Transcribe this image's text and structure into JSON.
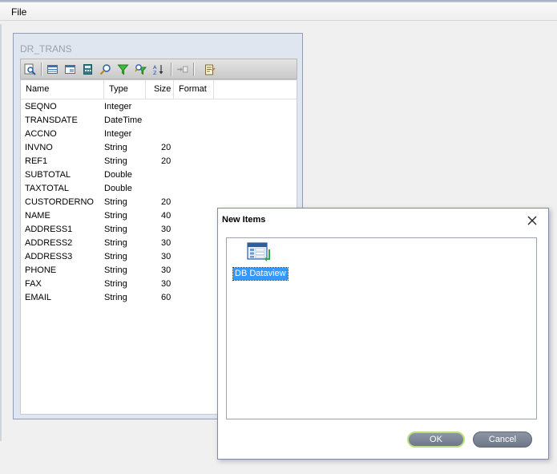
{
  "menu": {
    "file": "File"
  },
  "panel": {
    "title": "DR_TRANS",
    "toolbar": [
      "preview-icon",
      "table-icon",
      "table-properties-icon",
      "calculator-icon",
      "find-icon",
      "filter-icon",
      "find-filter-icon",
      "sort-icon",
      "insert-field-icon",
      "notes-icon"
    ],
    "columns": {
      "name": "Name",
      "type": "Type",
      "size": "Size",
      "format": "Format"
    },
    "rows": [
      {
        "name": "SEQNO",
        "type": "Integer",
        "size": ""
      },
      {
        "name": "TRANSDATE",
        "type": "DateTime",
        "size": ""
      },
      {
        "name": "ACCNO",
        "type": "Integer",
        "size": ""
      },
      {
        "name": "INVNO",
        "type": "String",
        "size": "20"
      },
      {
        "name": "REF1",
        "type": "String",
        "size": "20"
      },
      {
        "name": "SUBTOTAL",
        "type": "Double",
        "size": ""
      },
      {
        "name": "TAXTOTAL",
        "type": "Double",
        "size": ""
      },
      {
        "name": "CUSTORDERNO",
        "type": "String",
        "size": "20"
      },
      {
        "name": "NAME",
        "type": "String",
        "size": "40"
      },
      {
        "name": "ADDRESS1",
        "type": "String",
        "size": "30"
      },
      {
        "name": "ADDRESS2",
        "type": "String",
        "size": "30"
      },
      {
        "name": "ADDRESS3",
        "type": "String",
        "size": "30"
      },
      {
        "name": "PHONE",
        "type": "String",
        "size": "30"
      },
      {
        "name": "FAX",
        "type": "String",
        "size": "30"
      },
      {
        "name": "EMAIL",
        "type": "String",
        "size": "60"
      }
    ]
  },
  "dialog": {
    "title": "New Items",
    "close_icon": "close-icon",
    "items": [
      {
        "label": "DB Dataview",
        "icon": "db-dataview-icon",
        "selected": true
      }
    ],
    "ok": "OK",
    "cancel": "Cancel"
  },
  "colors": {
    "selection": "#3399ff",
    "ok_focus_border": "#b7e07a",
    "button_fill": "#7a8495",
    "panel_border": "#8e9fb5"
  }
}
